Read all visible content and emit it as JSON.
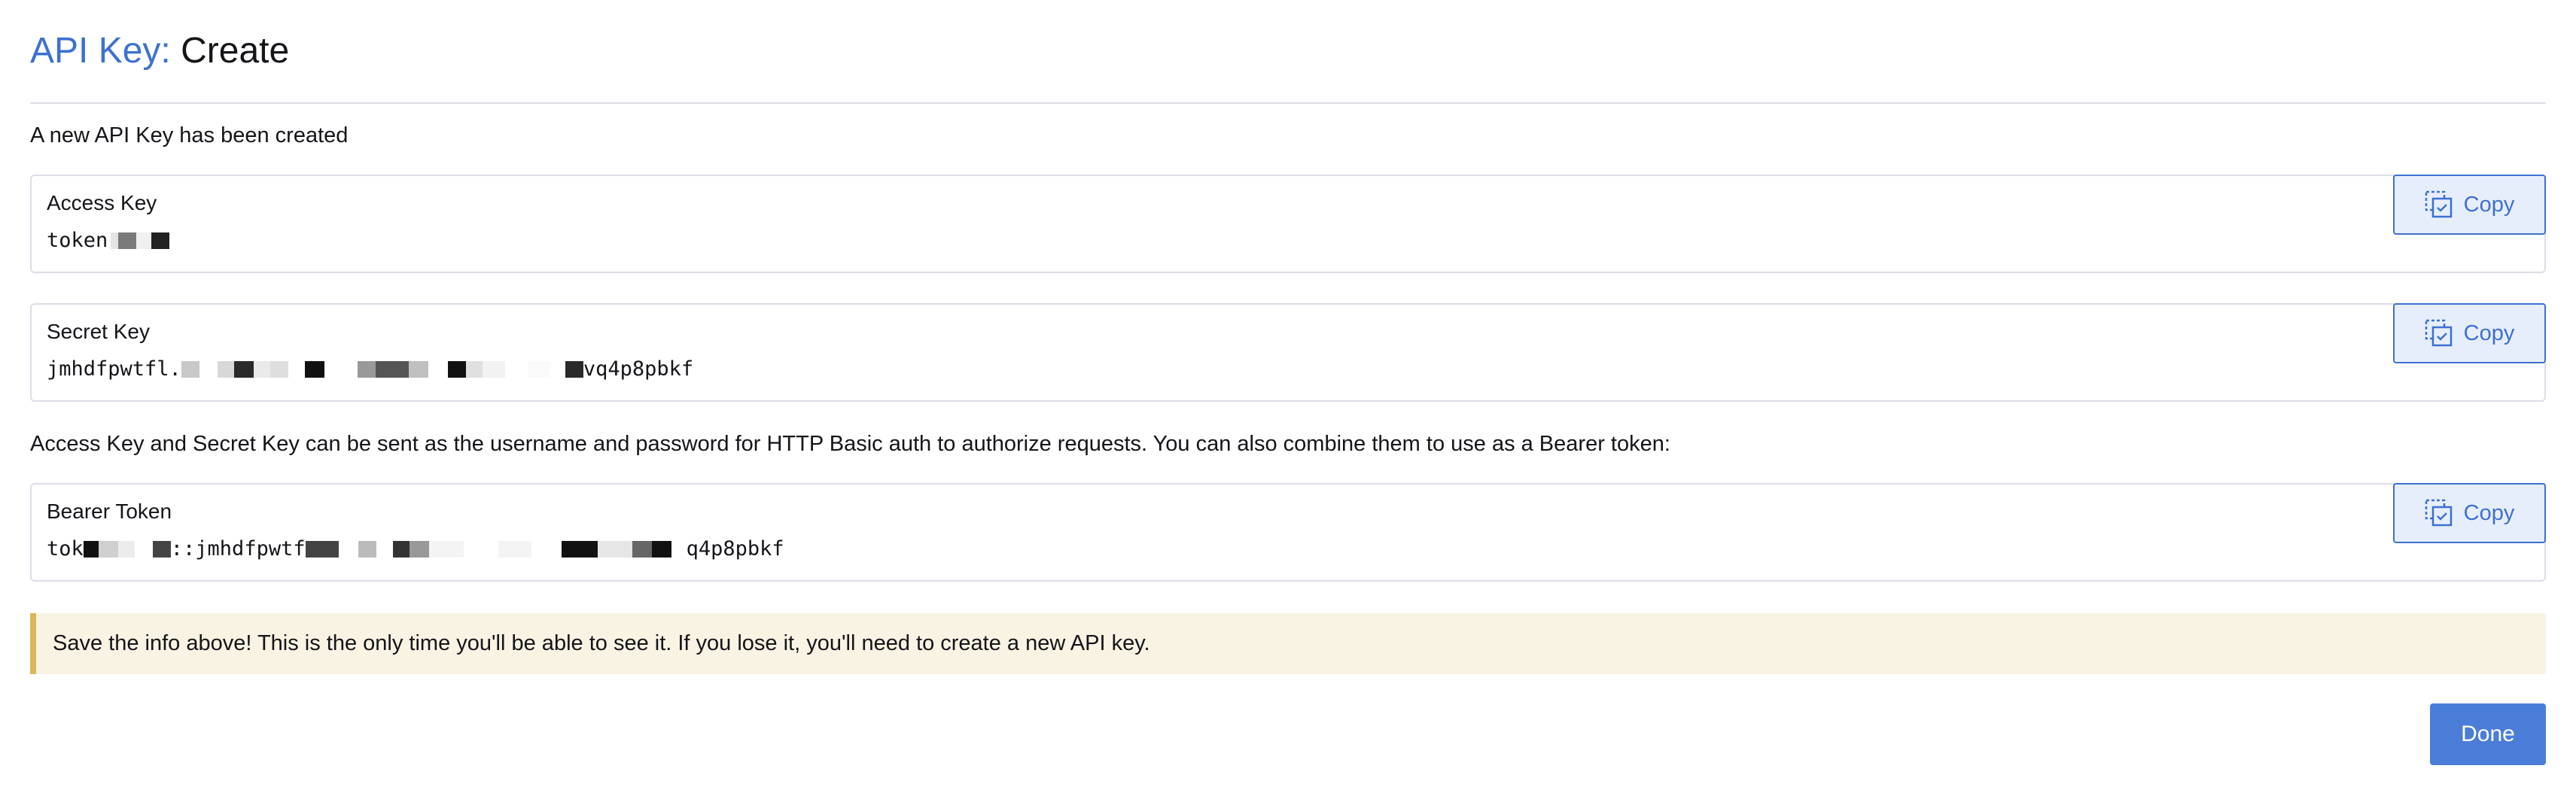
{
  "header": {
    "crumb": "API Key:",
    "page_name": "Create"
  },
  "intro_text": "A new API Key has been created",
  "access_key": {
    "label": "Access Key",
    "value_visible_start": "token",
    "value_visible_end": "",
    "copy_label": "Copy"
  },
  "secret_key": {
    "label": "Secret Key",
    "value_visible_start": "jmhdfpwtfl.",
    "value_visible_end": "vq4p8pbkf",
    "copy_label": "Copy"
  },
  "explain_text": "Access Key and Secret Key can be sent as the username and password for HTTP Basic auth to authorize requests. You can also combine them to use as a Bearer token:",
  "bearer_token": {
    "label": "Bearer Token",
    "value_visible_start": "tok",
    "value_visible_middle": "::jmhdfpwtf",
    "value_visible_end": "q4p8pbkf",
    "copy_label": "Copy"
  },
  "warning_text": "Save the info above! This is the only time you'll be able to see it. If you lose it, you'll need to create a new API key.",
  "done_label": "Done",
  "colors": {
    "accent": "#3d70d2",
    "done_button": "#4a7dd8",
    "warning_bg": "#f8f3e3",
    "warning_border": "#d9b75a",
    "copy_bg": "#e7eefb"
  },
  "icons": {
    "copy": "copy-icon"
  }
}
